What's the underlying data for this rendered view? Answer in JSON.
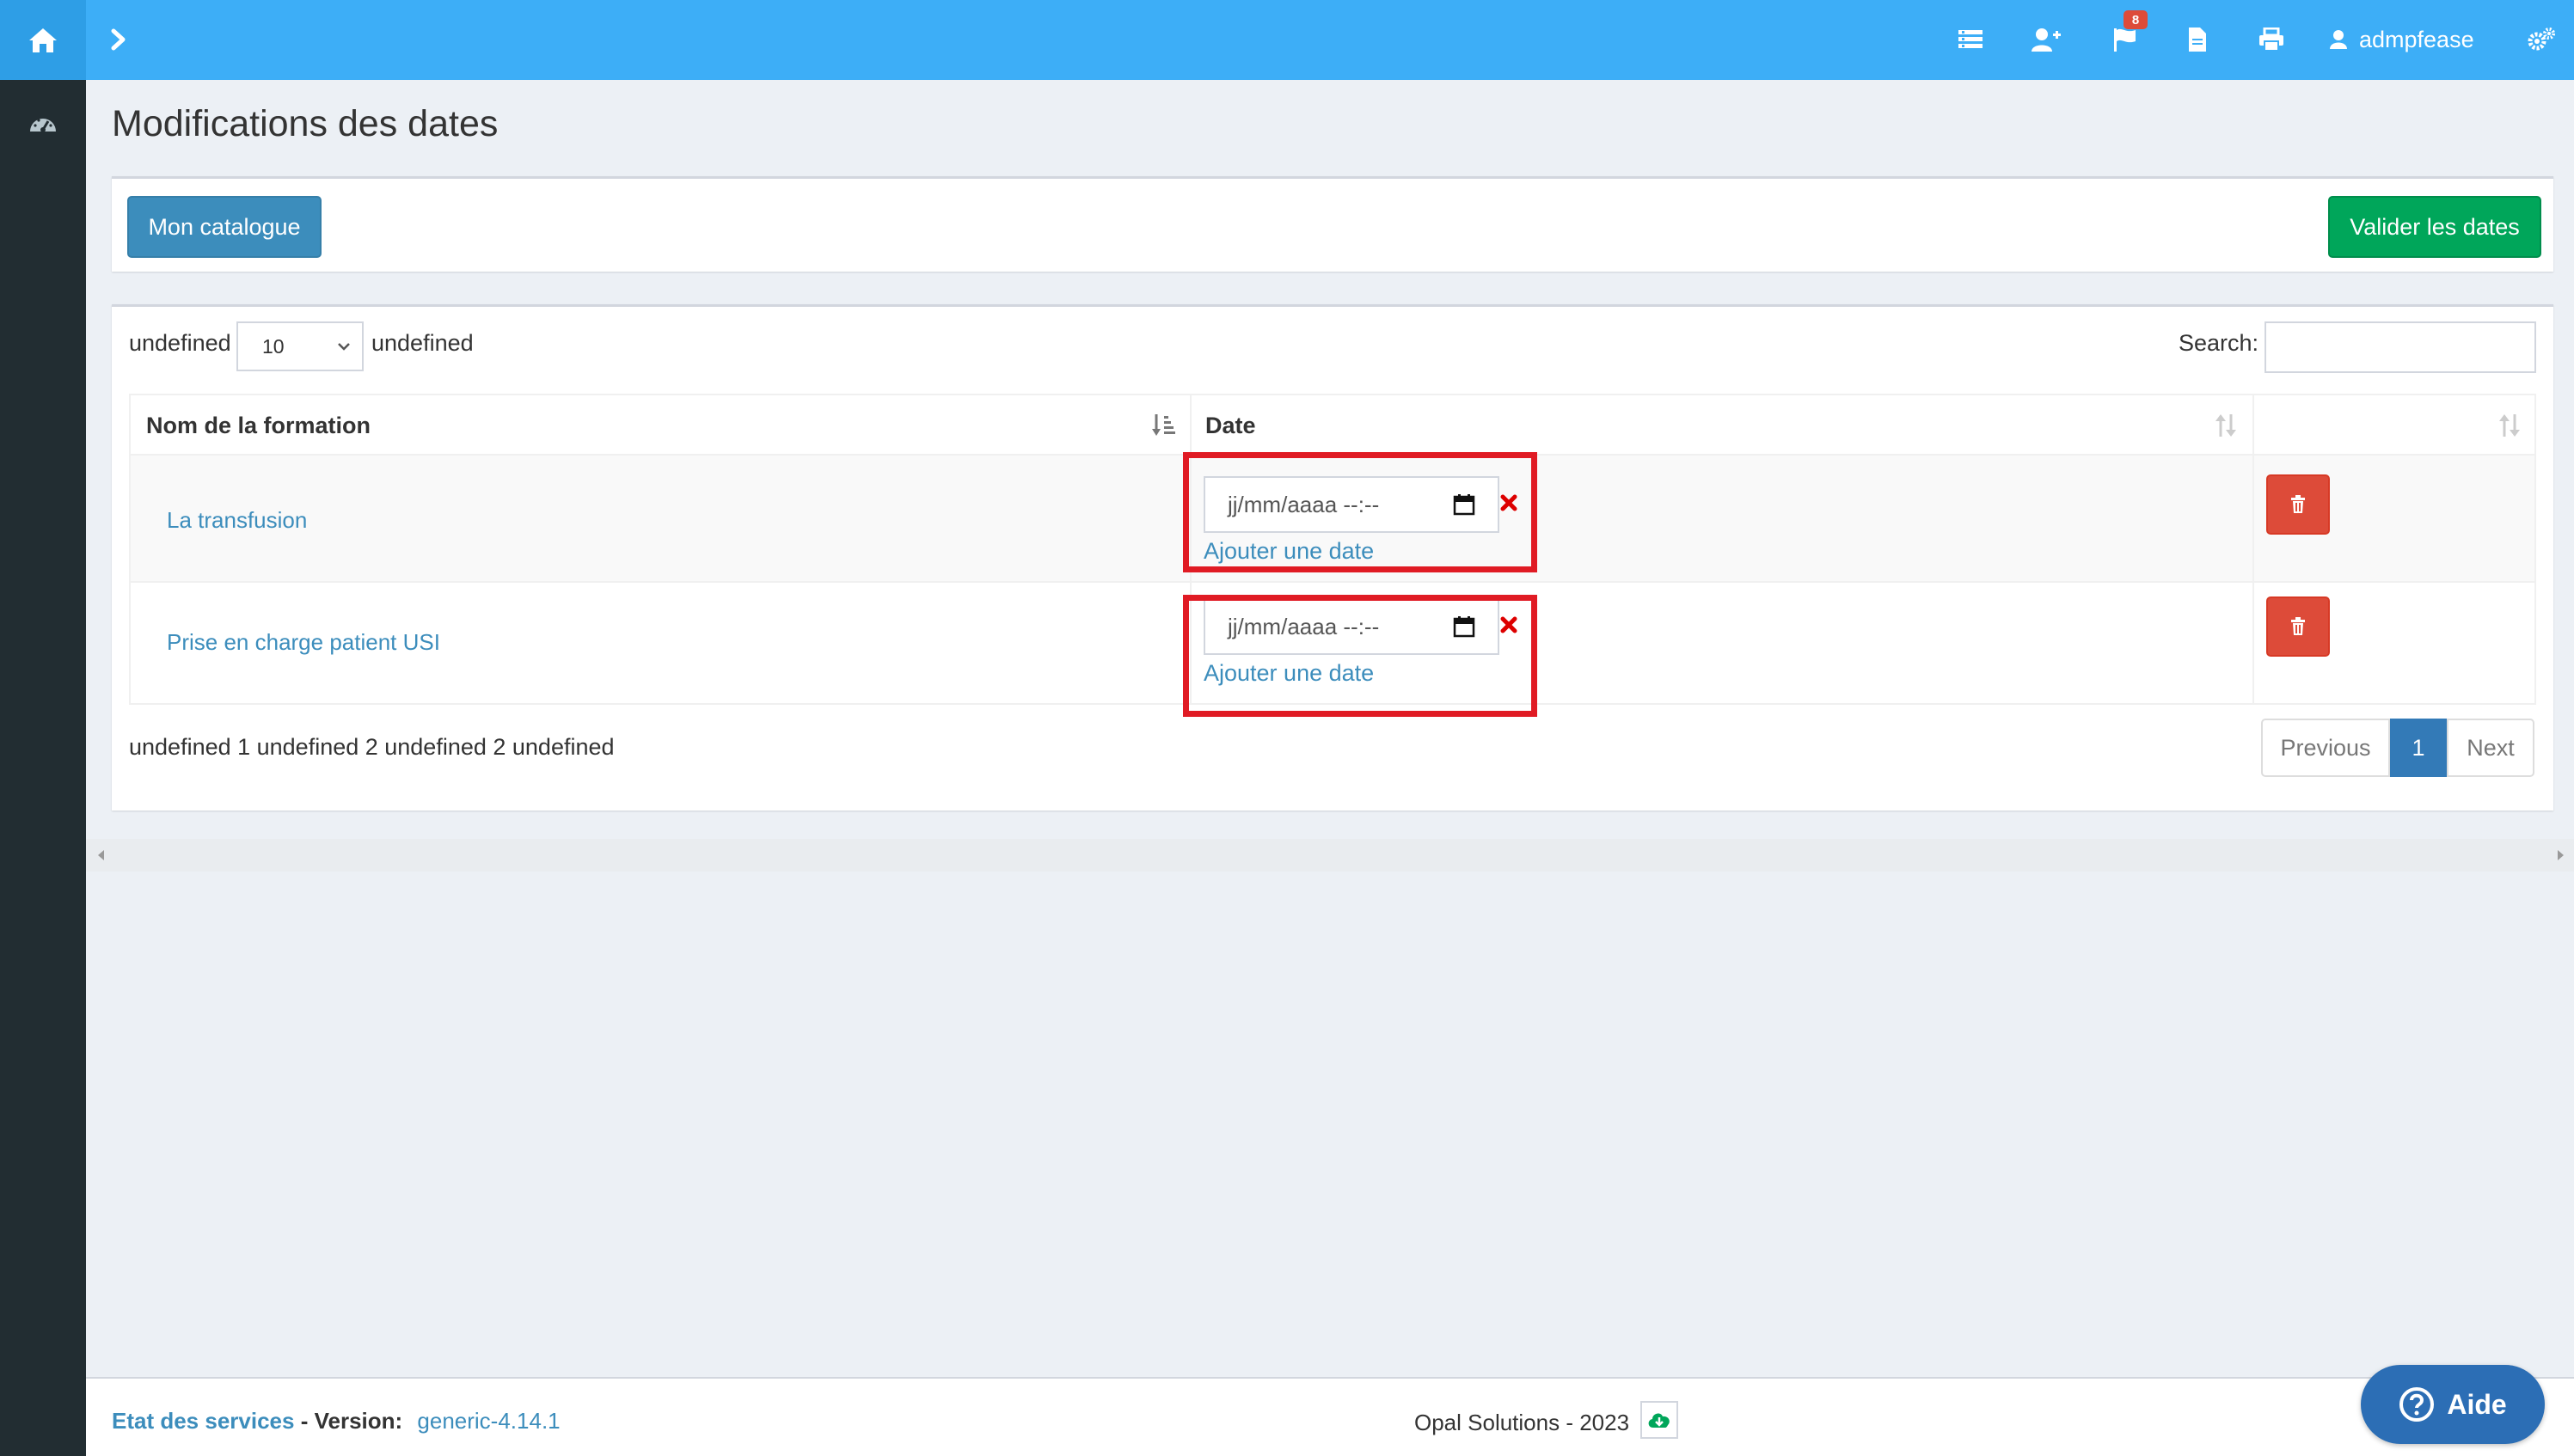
{
  "header": {
    "user_name": "admpfease",
    "flag_badge_count": "8",
    "icons": [
      "home-icon",
      "chevron-right-icon",
      "list-icon",
      "user-plus-icon",
      "flag-icon",
      "file-icon",
      "print-icon",
      "user-icon",
      "cogs-icon"
    ]
  },
  "sidebar": {
    "icons": [
      "dashboard-icon"
    ]
  },
  "page": {
    "title": "Modifications des dates"
  },
  "toolbar": {
    "catalogue_label": "Mon catalogue",
    "validate_label": "Valider les dates"
  },
  "table_controls": {
    "length_prefix": "undefined",
    "length_value": "10",
    "length_suffix": "undefined",
    "search_label": "Search:",
    "search_value": ""
  },
  "table": {
    "columns": [
      "Nom de la formation",
      "Date",
      ""
    ],
    "rows": [
      {
        "formation": "La transfusion",
        "date_placeholder": "jj/mm/aaaa --:--",
        "add_date": "Ajouter une date"
      },
      {
        "formation": "Prise en charge patient USI",
        "date_placeholder": "jj/mm/aaaa --:--",
        "add_date": "Ajouter une date"
      }
    ]
  },
  "table_info": "undefined 1 undefined 2 undefined 2 undefined",
  "pagination": {
    "previous": "Previous",
    "current": "1",
    "next": "Next"
  },
  "footer": {
    "status_link": "Etat des services",
    "separator": " - ",
    "version_label": "Version:",
    "version_value": "generic-4.14.1",
    "copyright": "Opal Solutions - 2023"
  },
  "help_button": {
    "label": "Aide"
  },
  "colors": {
    "topbar": "#3daef7",
    "sidebar": "#222d32",
    "primary": "#3c8dbc",
    "success": "#00a65a",
    "danger": "#dd4b39",
    "highlight": "#e01b24"
  }
}
